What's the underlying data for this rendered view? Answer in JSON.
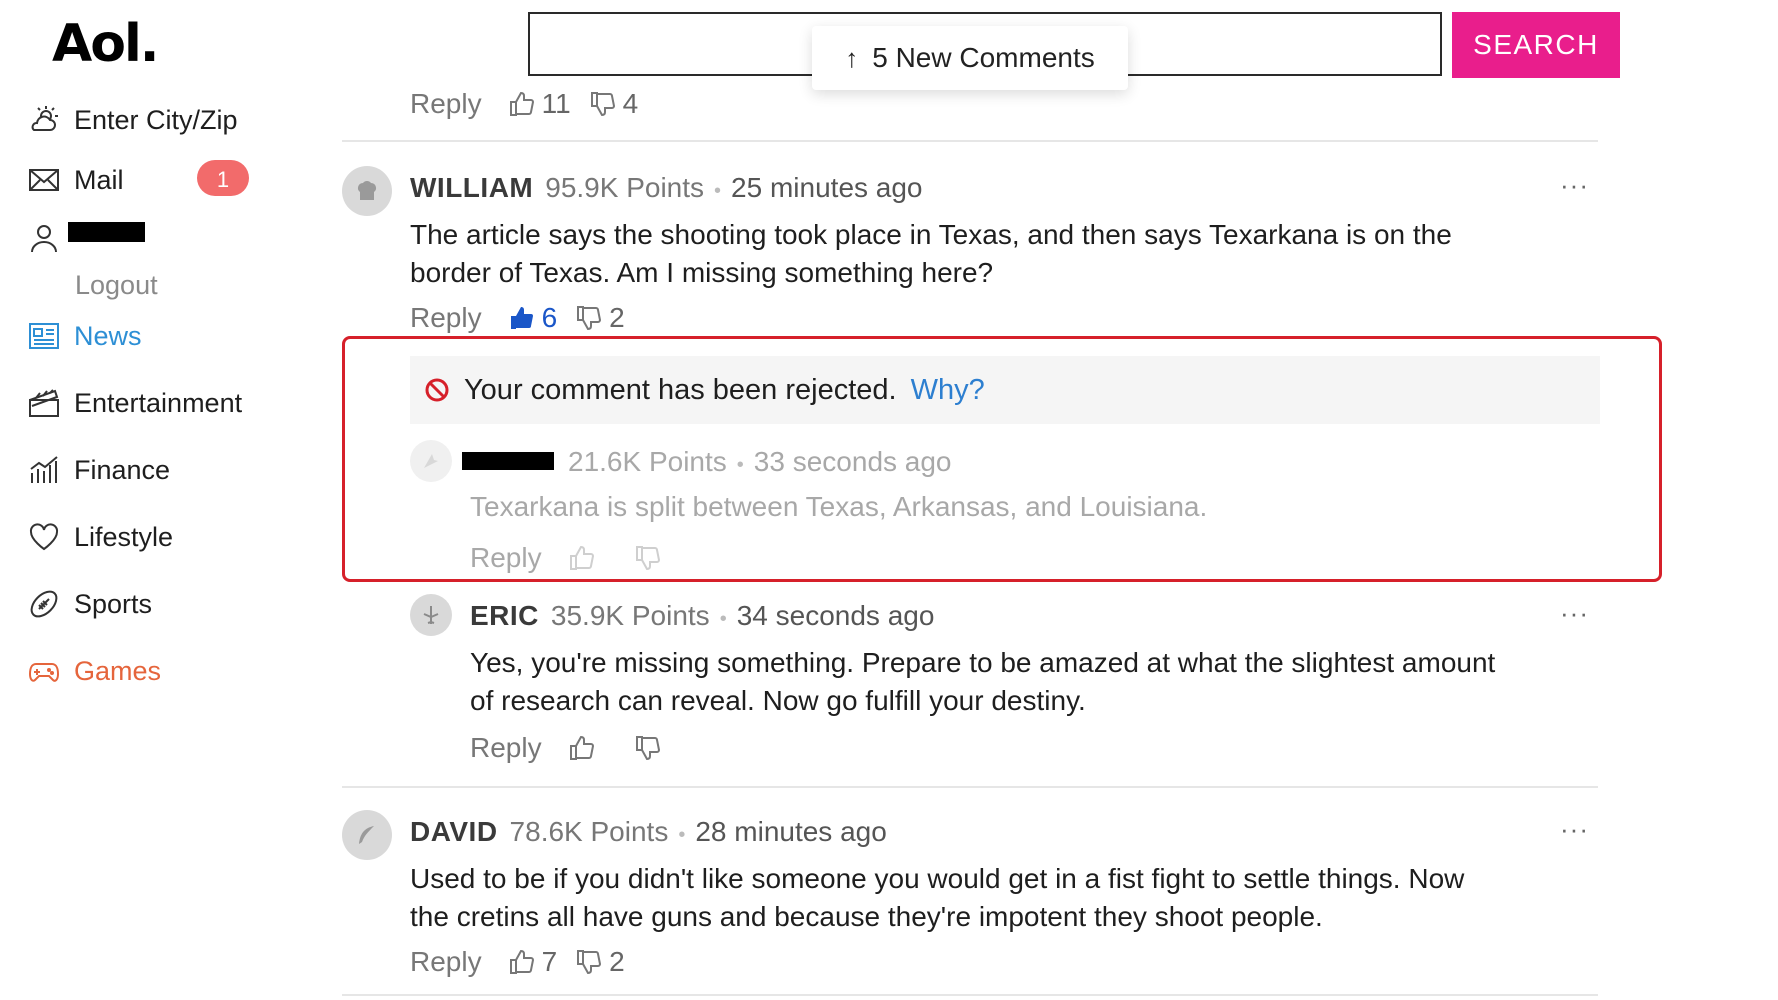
{
  "logo": "Aol.",
  "sidebar": {
    "weather_label": "Enter City/Zip",
    "mail_label": "Mail",
    "mail_badge": "1",
    "logout_label": "Logout",
    "items": [
      {
        "label": "News",
        "icon": "news-icon"
      },
      {
        "label": "Entertainment",
        "icon": "clapperboard-icon"
      },
      {
        "label": "Finance",
        "icon": "chart-icon"
      },
      {
        "label": "Lifestyle",
        "icon": "heart-icon"
      },
      {
        "label": "Sports",
        "icon": "football-icon"
      },
      {
        "label": "Games",
        "icon": "gamepad-icon"
      }
    ]
  },
  "header": {
    "search_placeholder": "",
    "search_button": "SEARCH",
    "new_comments": "5 New Comments",
    "new_comments_icon": "arrow-up-icon"
  },
  "top_actions": {
    "reply": "Reply",
    "likes": "11",
    "dislikes": "4"
  },
  "comments": [
    {
      "author": "WILLIAM",
      "points": "95.9K Points",
      "time": "25 minutes ago",
      "lines": [
        "The article says the shooting took place in Texas, and then says Texarkana is on the",
        "border of Texas.  Am I missing something here?"
      ],
      "reply": "Reply",
      "likes": "6",
      "dislikes": "2",
      "more": "···"
    },
    {
      "author": "ERIC",
      "points": "35.9K Points",
      "time": "34 seconds ago",
      "lines": [
        "Yes, you're missing something.  Prepare to be amazed at what the slightest amount",
        "of research can reveal.  Now go fulfill your destiny."
      ],
      "reply": "Reply",
      "more": "···"
    },
    {
      "author": "DAVID",
      "points": "78.6K Points",
      "time": "28 minutes ago",
      "lines": [
        "Used to be if you didn't like someone you would get in a fist fight to settle things.  Now",
        "the cretins all have guns and because they're impotent they shoot people."
      ],
      "reply": "Reply",
      "likes": "7",
      "dislikes": "2",
      "more": "···"
    }
  ],
  "rejected": {
    "message": "Your comment has been rejected.",
    "why": "Why?",
    "points": "21.6K Points",
    "time": "33 seconds ago",
    "text": "Texarkana is split between Texas, Arkansas, and Louisiana.",
    "reply": "Reply"
  },
  "colors": {
    "search_button": "#e91e8c",
    "badge": "#f26b6b",
    "news": "#2d8fd5",
    "games": "#e5653c",
    "link": "#2d7fd0",
    "reject_frame": "#d6202a",
    "liked": "#1a56c8"
  }
}
